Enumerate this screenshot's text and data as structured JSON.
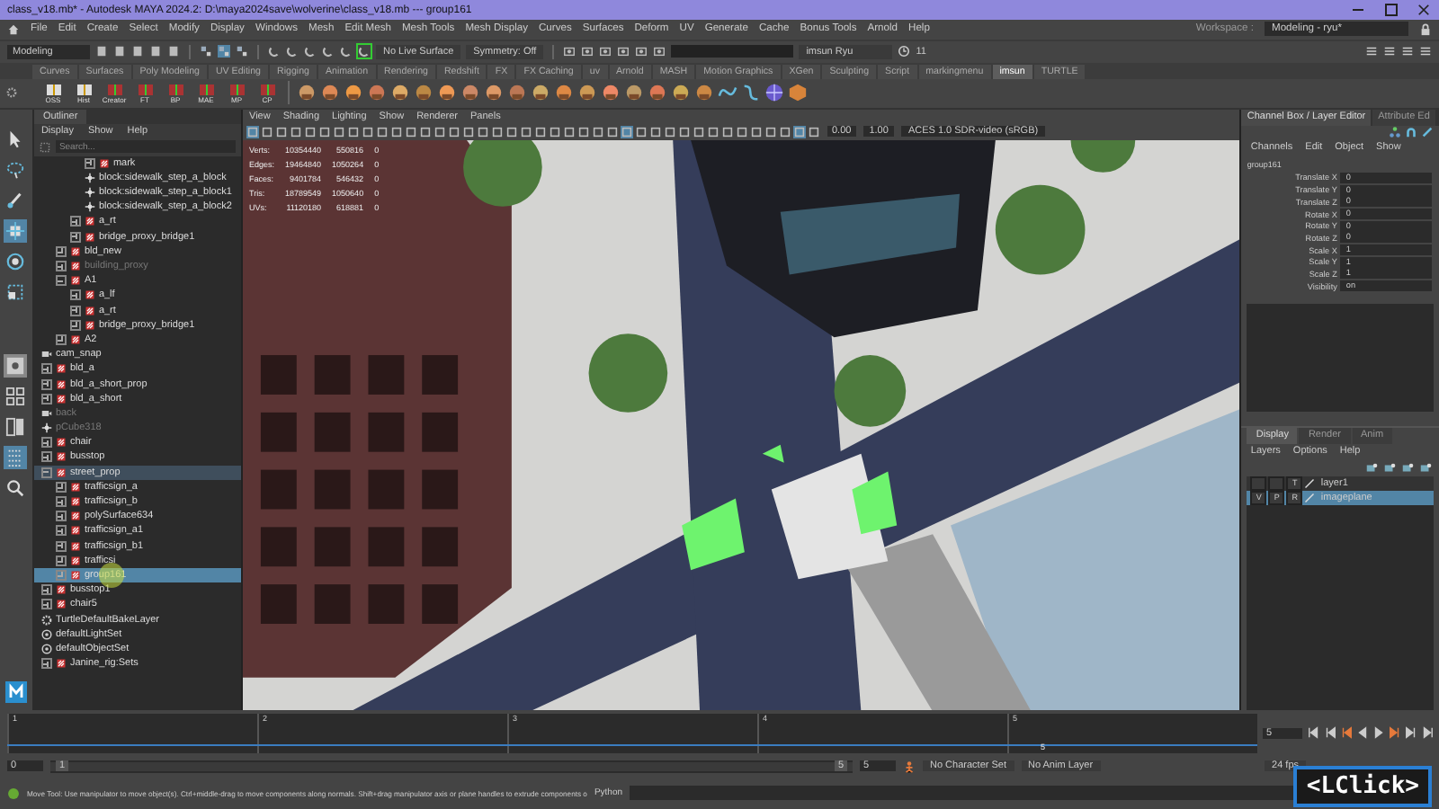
{
  "window": {
    "title": "class_v18.mb* - Autodesk MAYA 2024.2: D:\\maya2024save\\wolverine\\class_v18.mb  ---  group161"
  },
  "menu": [
    "File",
    "Edit",
    "Create",
    "Select",
    "Modify",
    "Display",
    "Windows",
    "Mesh",
    "Edit Mesh",
    "Mesh Tools",
    "Mesh Display",
    "Curves",
    "Surfaces",
    "Deform",
    "UV",
    "Generate",
    "Cache",
    "Bonus Tools",
    "Arnold",
    "Help"
  ],
  "workspace": {
    "label": "Workspace :",
    "value": "Modeling - ryu*"
  },
  "status_line": {
    "mode": "Modeling",
    "live_surface": "No Live Surface",
    "symmetry": "Symmetry: Off",
    "user": "imsun Ryu",
    "count": "11"
  },
  "shelf_tabs": [
    {
      "label": "Curves",
      "selected": false
    },
    {
      "label": "Surfaces",
      "selected": false
    },
    {
      "label": "Poly Modeling",
      "selected": false
    },
    {
      "label": "UV Editing",
      "selected": false
    },
    {
      "label": "Rigging",
      "selected": false
    },
    {
      "label": "Animation",
      "selected": false
    },
    {
      "label": "Rendering",
      "selected": false
    },
    {
      "label": "Redshift",
      "selected": false
    },
    {
      "label": "FX",
      "selected": false
    },
    {
      "label": "FX Caching",
      "selected": false
    },
    {
      "label": "uv",
      "selected": false
    },
    {
      "label": "Arnold",
      "selected": false
    },
    {
      "label": "MASH",
      "selected": false
    },
    {
      "label": "Motion Graphics",
      "selected": false
    },
    {
      "label": "XGen",
      "selected": false
    },
    {
      "label": "Sculpting",
      "selected": false
    },
    {
      "label": "Script",
      "selected": false
    },
    {
      "label": "markingmenu",
      "selected": false
    },
    {
      "label": "imsun",
      "selected": true
    },
    {
      "label": "TURTLE",
      "selected": false
    }
  ],
  "shelf_buttons": [
    "OSS",
    "Hist",
    "Creator",
    "FT",
    "BP",
    "MAE",
    "MP",
    "CP"
  ],
  "outliner": {
    "title": "Outliner",
    "menu": [
      "Display",
      "Show",
      "Help"
    ],
    "search": {
      "placeholder": "Search..."
    },
    "items": [
      {
        "children": [
          {
            "children": [
              {
                "children": [
                  {
                    "label": "mark",
                    "kind": "group",
                    "hidden": false,
                    "selected": false,
                    "highlighted": false
                  },
                  {
                    "label": "block:sidewalk_step_a_block",
                    "kind": "locator",
                    "hidden": false,
                    "selected": false,
                    "highlighted": false
                  },
                  {
                    "label": "block:sidewalk_step_a_block1",
                    "kind": "locator",
                    "hidden": false,
                    "selected": false,
                    "highlighted": false
                  },
                  {
                    "label": "block:sidewalk_step_a_block2",
                    "kind": "locator",
                    "hidden": false,
                    "selected": false,
                    "highlighted": false
                  }
                ]
              },
              {
                "label": "a_rt",
                "kind": "group",
                "hidden": false,
                "selected": false,
                "highlighted": false
              },
              {
                "label": "bridge_proxy_bridge1",
                "kind": "group",
                "hidden": false,
                "selected": false,
                "highlighted": false
              }
            ]
          },
          {
            "label": "bld_new",
            "kind": "group",
            "hidden": false,
            "selected": false,
            "highlighted": false
          },
          {
            "label": "building_proxy",
            "kind": "group",
            "hidden": true,
            "selected": false,
            "highlighted": false
          },
          {
            "label": "A1",
            "kind": "group",
            "hidden": false,
            "selected": false,
            "highlighted": false,
            "children": [
              {
                "label": "a_lf",
                "kind": "group",
                "hidden": false,
                "selected": false,
                "highlighted": false
              },
              {
                "label": "a_rt",
                "kind": "group",
                "hidden": false,
                "selected": false,
                "highlighted": false
              },
              {
                "label": "bridge_proxy_bridge1",
                "kind": "group",
                "hidden": false,
                "selected": false,
                "highlighted": false
              }
            ]
          },
          {
            "label": "A2",
            "kind": "group",
            "hidden": false,
            "selected": false,
            "highlighted": false
          }
        ]
      },
      {
        "label": "cam_snap",
        "kind": "camera",
        "hidden": false,
        "selected": false,
        "highlighted": false
      },
      {
        "label": "bld_a",
        "kind": "group",
        "hidden": false,
        "selected": false,
        "highlighted": false
      },
      {
        "label": "bld_a_short_prop",
        "kind": "group",
        "hidden": false,
        "selected": false,
        "highlighted": false
      },
      {
        "label": "bld_a_short",
        "kind": "group",
        "hidden": false,
        "selected": false,
        "highlighted": false
      },
      {
        "label": "back",
        "kind": "camera",
        "hidden": true,
        "selected": false,
        "highlighted": false
      },
      {
        "label": "pCube318",
        "kind": "locator",
        "hidden": true,
        "selected": false,
        "highlighted": false
      },
      {
        "label": "chair",
        "kind": "group",
        "hidden": false,
        "selected": false,
        "highlighted": false
      },
      {
        "label": "busstop",
        "kind": "group",
        "hidden": false,
        "selected": false,
        "highlighted": false
      },
      {
        "label": "street_prop",
        "kind": "group",
        "hidden": false,
        "selected": false,
        "highlighted": true,
        "children": [
          {
            "label": "trafficsign_a",
            "kind": "group",
            "hidden": false,
            "selected": false,
            "highlighted": false
          },
          {
            "label": "trafficsign_b",
            "kind": "group",
            "hidden": false,
            "selected": false,
            "highlighted": false
          },
          {
            "label": "polySurface634",
            "kind": "group",
            "hidden": false,
            "selected": false,
            "highlighted": false
          },
          {
            "label": "trafficsign_a1",
            "kind": "group",
            "hidden": false,
            "selected": false,
            "highlighted": false
          },
          {
            "label": "trafficsign_b1",
            "kind": "group",
            "hidden": false,
            "selected": false,
            "highlighted": false
          },
          {
            "label": "trafficsi",
            "kind": "group",
            "hidden": false,
            "selected": false,
            "highlighted": false
          },
          {
            "label": "group161",
            "kind": "group",
            "hidden": false,
            "selected": true,
            "highlighted": false
          }
        ]
      },
      {
        "label": "busstop1",
        "kind": "group",
        "hidden": false,
        "selected": false,
        "highlighted": false
      },
      {
        "label": "chair5",
        "kind": "group",
        "hidden": false,
        "selected": false,
        "highlighted": false
      },
      {
        "label": "TurtleDefaultBakeLayer",
        "kind": "layer",
        "hidden": false,
        "selected": false,
        "highlighted": false
      },
      {
        "label": "defaultLightSet",
        "kind": "set",
        "hidden": false,
        "selected": false,
        "highlighted": false
      },
      {
        "label": "defaultObjectSet",
        "kind": "set",
        "hidden": false,
        "selected": false,
        "highlighted": false
      },
      {
        "label": "Janine_rig:Sets",
        "kind": "group",
        "hidden": false,
        "selected": false,
        "highlighted": false
      }
    ]
  },
  "viewport": {
    "menu": [
      "View",
      "Shading",
      "Lighting",
      "Show",
      "Renderer",
      "Panels"
    ],
    "stats": [
      {
        "name": "Verts:",
        "values": [
          "10354440",
          "550816",
          "0"
        ]
      },
      {
        "name": "Edges:",
        "values": [
          "19464840",
          "1050264",
          "0"
        ]
      },
      {
        "name": "Faces:",
        "values": [
          "9401784",
          "546432",
          "0"
        ]
      },
      {
        "name": "Tris:",
        "values": [
          "18789549",
          "1050640",
          "0"
        ]
      },
      {
        "name": "UVs:",
        "values": [
          "11120180",
          "618881",
          "0"
        ]
      }
    ],
    "exposure": "0.00",
    "gamma": "1.00",
    "color_space": "ACES 1.0 SDR-video (sRGB)"
  },
  "channel_box": {
    "tabs": [
      {
        "label": "Channel Box / Layer Editor",
        "selected": true
      },
      {
        "label": "Attribute Ed",
        "selected": false
      }
    ],
    "menu": [
      "Channels",
      "Edit",
      "Object",
      "Show"
    ],
    "object": "group161",
    "attributes": [
      {
        "name": "Translate X",
        "value": "0"
      },
      {
        "name": "Translate Y",
        "value": "0"
      },
      {
        "name": "Translate Z",
        "value": "0"
      },
      {
        "name": "Rotate X",
        "value": "0"
      },
      {
        "name": "Rotate Y",
        "value": "0"
      },
      {
        "name": "Rotate Z",
        "value": "0"
      },
      {
        "name": "Scale X",
        "value": "1"
      },
      {
        "name": "Scale Y",
        "value": "1"
      },
      {
        "name": "Scale Z",
        "value": "1"
      },
      {
        "name": "Visibility",
        "value": "on"
      }
    ]
  },
  "layer_editor": {
    "tabs": [
      {
        "label": "Display",
        "selected": true
      },
      {
        "label": "Render",
        "selected": false
      },
      {
        "label": "Anim",
        "selected": false
      }
    ],
    "menu": [
      "Layers",
      "Options",
      "Help"
    ],
    "layers": [
      {
        "name": "layer1",
        "flags": [
          "T"
        ],
        "selected": false
      },
      {
        "name": "imageplane",
        "flags": [
          "V",
          "P",
          "R"
        ],
        "selected": true
      }
    ]
  },
  "timeline": {
    "ticks": [
      "1",
      "2",
      "3",
      "4",
      "5"
    ],
    "level": 1,
    "current": "5",
    "current_field": "5"
  },
  "range": {
    "level": 1,
    "start": "0",
    "inner_start": "1",
    "inner_end": "5",
    "end": "5",
    "character_set": "No Character Set",
    "anim_layer": "No Anim Layer",
    "fps": "24 fps"
  },
  "help_line": "Move Tool: Use manipulator to move object(s). Ctrl+middle-drag to move components along normals. Shift+drag manipulator axis or plane handles to extrude components o",
  "command": {
    "language": "Python"
  },
  "key_overlay": "<LClick>"
}
